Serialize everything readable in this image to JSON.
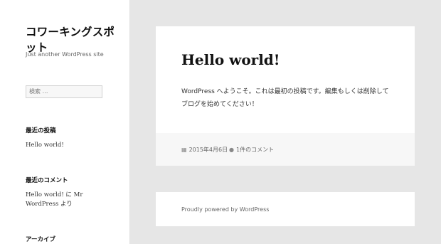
{
  "sidebar": {
    "site_title": "コワーキングスポット",
    "site_description": "Just another WordPress site",
    "search_placeholder": "検索 …",
    "recent_posts_title": "最近の投稿",
    "recent_posts": [
      "Hello world!"
    ],
    "recent_comments_title": "最近のコメント",
    "recent_comment": {
      "post": "Hello world!",
      "middle": " に ",
      "author": "Mr WordPress",
      "suffix": " より"
    },
    "archives_title": "アーカイブ"
  },
  "post": {
    "title": "Hello world!",
    "body": "WordPress へようこそ。これは最初の投稿です。編集もしくは削除してブログを始めてください！",
    "date": "2015年4月6日",
    "comments": "1件のコメント",
    "date_icon": "calendar-icon",
    "comment_icon": "comment-icon"
  },
  "footer": {
    "credit": "Proudly powered by WordPress"
  }
}
